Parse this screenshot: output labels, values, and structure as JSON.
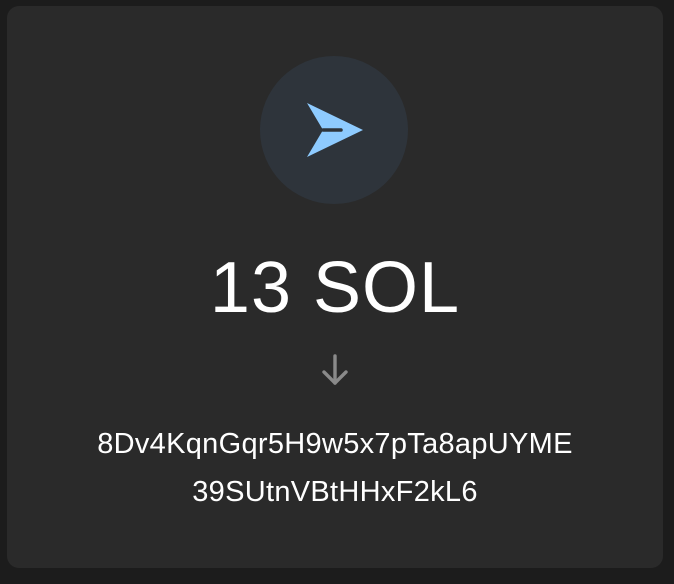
{
  "transfer": {
    "icon": "send-icon",
    "amount": "13 SOL",
    "direction_icon": "arrow-down-icon",
    "recipient_address_line1": "8Dv4KqnGqr5H9w5x7pTa8apUYME",
    "recipient_address_line2": "39SUtnVBtHHxF2kL6"
  },
  "colors": {
    "background": "#1c1c1c",
    "card": "#2a2a2a",
    "icon_circle": "#2e343b",
    "accent": "#8ecbff",
    "text": "#ffffff",
    "muted": "#8a8a8a"
  }
}
